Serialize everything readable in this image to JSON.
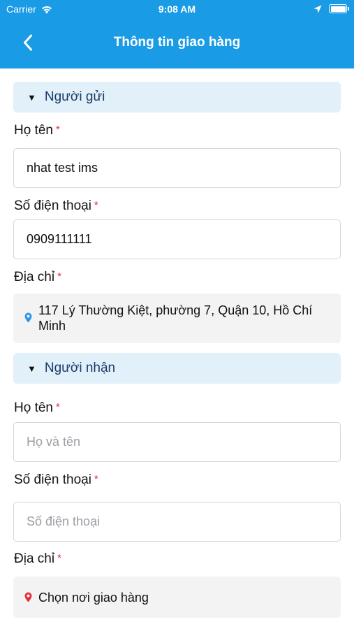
{
  "status_bar": {
    "carrier": "Carrier",
    "time": "9:08 AM"
  },
  "nav": {
    "title": "Thông tin giao hàng"
  },
  "sender": {
    "section_label": "Người gửi",
    "name_label": "Họ tên",
    "name_value": "nhat test ims",
    "phone_label": "Số điện thoại",
    "phone_value": "0909111111",
    "address_label": "Địa chỉ",
    "address_value": "117 Lý Thường Kiệt, phường 7, Quận 10, Hồ Chí Minh"
  },
  "receiver": {
    "section_label": "Người nhận",
    "name_label": "Họ tên",
    "name_placeholder": "Họ và tên",
    "phone_label": "Số điện thoại",
    "phone_placeholder": "Số điện thoại",
    "address_label": "Địa chỉ",
    "address_placeholder": "Chọn nơi giao hàng"
  },
  "required_marker": "*",
  "colors": {
    "header": "#1a9be6",
    "section_bg": "#e2f0fa",
    "required": "#e5303a",
    "pin_blue": "#2b95e8",
    "pin_red": "#e5303a"
  },
  "icons": [
    "wifi-icon",
    "back-chevron-icon",
    "location-arrow-icon",
    "battery-icon",
    "caret-down-icon",
    "map-pin-icon"
  ]
}
